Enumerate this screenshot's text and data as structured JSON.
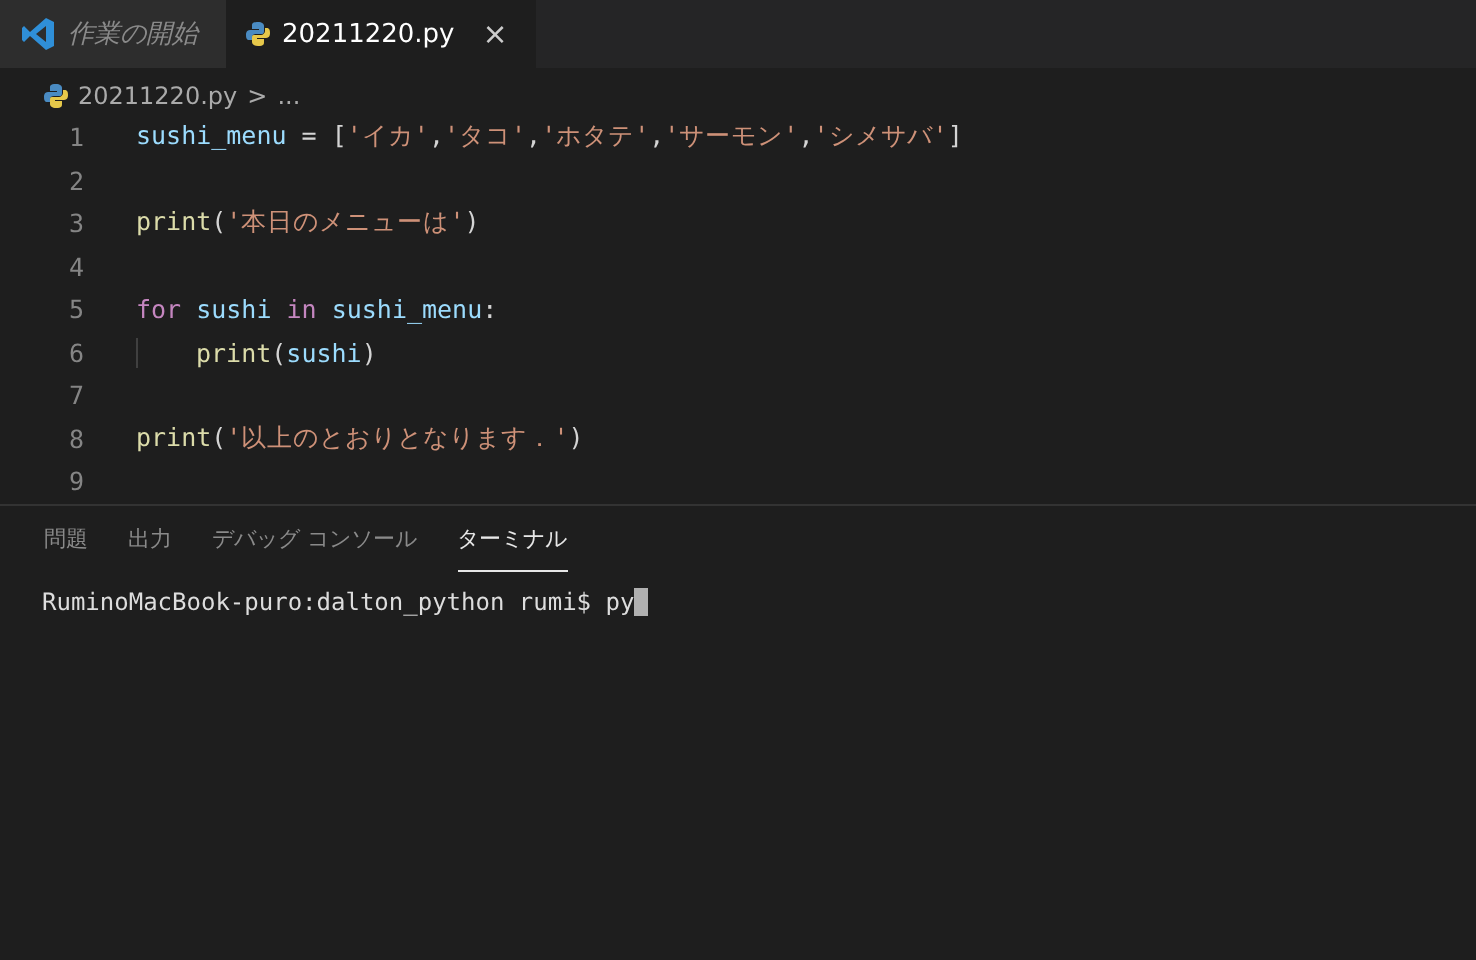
{
  "tabs": [
    {
      "label": "作業の開始",
      "selected": false,
      "kind": "welcome"
    },
    {
      "label": "20211220.py",
      "selected": true,
      "kind": "python",
      "close": "×"
    }
  ],
  "breadcrumb": {
    "file": "20211220.py",
    "separator": ">",
    "rest": "..."
  },
  "code_lines": [
    {
      "number": "1",
      "tokens": [
        {
          "kind": "var",
          "text": "sushi_menu"
        },
        {
          "kind": "plain",
          "text": " = ["
        },
        {
          "kind": "str",
          "text": "'イカ'"
        },
        {
          "kind": "plain",
          "text": ","
        },
        {
          "kind": "str",
          "text": "'タコ'"
        },
        {
          "kind": "plain",
          "text": ","
        },
        {
          "kind": "str",
          "text": "'ホタテ'"
        },
        {
          "kind": "plain",
          "text": ","
        },
        {
          "kind": "str",
          "text": "'サーモン'"
        },
        {
          "kind": "plain",
          "text": ","
        },
        {
          "kind": "str",
          "text": "'シメサバ'"
        },
        {
          "kind": "plain",
          "text": "]"
        }
      ]
    },
    {
      "number": "2"
    },
    {
      "number": "3",
      "tokens": [
        {
          "kind": "fn",
          "text": "print"
        },
        {
          "kind": "plain",
          "text": "("
        },
        {
          "kind": "str",
          "text": "'本日のメニューは'"
        },
        {
          "kind": "plain",
          "text": ")"
        }
      ]
    },
    {
      "number": "4"
    },
    {
      "number": "5",
      "tokens": [
        {
          "kind": "kw",
          "text": "for "
        },
        {
          "kind": "var",
          "text": "sushi "
        },
        {
          "kind": "kw",
          "text": "in "
        },
        {
          "kind": "var",
          "text": "sushi_menu"
        },
        {
          "kind": "plain",
          "text": ":"
        }
      ]
    },
    {
      "number": "6",
      "indent": true,
      "tokens": [
        {
          "kind": "fn",
          "text": "print"
        },
        {
          "kind": "plain",
          "text": "("
        },
        {
          "kind": "var",
          "text": "sushi"
        },
        {
          "kind": "plain",
          "text": ")"
        }
      ]
    },
    {
      "number": "7"
    },
    {
      "number": "8",
      "tokens": [
        {
          "kind": "fn",
          "text": "print"
        },
        {
          "kind": "plain",
          "text": "("
        },
        {
          "kind": "str",
          "text": "'以上のとおりとなります．'"
        },
        {
          "kind": "plain",
          "text": ")"
        }
      ]
    },
    {
      "number": "9"
    }
  ],
  "panel_tabs": [
    {
      "label": "問題",
      "selected": false
    },
    {
      "label": "出力",
      "selected": false
    },
    {
      "label": "デバッグ コンソール",
      "selected": false
    },
    {
      "label": "ターミナル",
      "selected": true
    }
  ],
  "terminal": {
    "prompt": "RuminoMacBook-puro:dalton_python rumi$ py"
  }
}
